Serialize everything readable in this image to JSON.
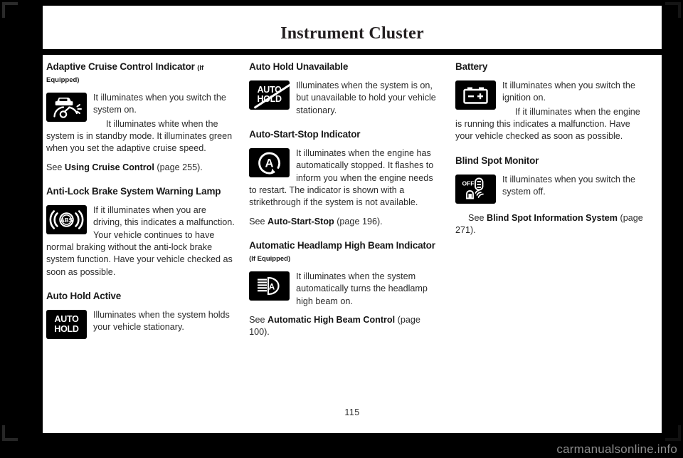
{
  "header": {
    "title": "Instrument Cluster"
  },
  "footer": {
    "page_number": "115",
    "watermark": "carmanualsonline.info"
  },
  "columns": [
    {
      "id": "column-left",
      "sections": [
        {
          "id": "adaptive-cruise-control-indicator",
          "title": "Adaptive Cruise Control Indicator",
          "qualifier": "(If Equipped)",
          "icon": "adaptive-cruise-control-icon",
          "icon_label": "",
          "paragraphs": [
            "It illuminates when you switch the system on.",
            "It illuminates white when the system is in standby mode.  It illuminates green when you set the adaptive cruise speed."
          ],
          "see_prefix": "See ",
          "see_bold": "Using Cruise Control",
          "see_suffix": " (page 255)."
        },
        {
          "id": "anti-lock-brake-system-warning-lamp",
          "title": "Anti-Lock Brake System Warning Lamp",
          "qualifier": "",
          "icon": "abs-warning-icon",
          "icon_label": "ABS",
          "paragraphs": [
            "If it illuminates when you are driving, this indicates a malfunction.  Your vehicle continues to have normal braking without the anti-lock brake system function.  Have your vehicle checked as soon as possible."
          ],
          "see_prefix": "",
          "see_bold": "",
          "see_suffix": ""
        },
        {
          "id": "auto-hold-active",
          "title": "Auto Hold Active",
          "qualifier": "",
          "icon": "auto-hold-icon",
          "icon_label_line1": "AUTO",
          "icon_label_line2": "HOLD",
          "paragraphs": [
            "Illuminates when the system holds your vehicle stationary."
          ],
          "see_prefix": "",
          "see_bold": "",
          "see_suffix": ""
        }
      ]
    },
    {
      "id": "column-middle",
      "sections": [
        {
          "id": "auto-hold-unavailable",
          "title": "Auto Hold Unavailable",
          "qualifier": "",
          "icon": "auto-hold-unavailable-icon",
          "icon_label_line1": "AUTO",
          "icon_label_line2": "HOLD",
          "paragraphs": [
            "Illuminates when the system is on, but unavailable to hold your vehicle stationary."
          ],
          "see_prefix": "",
          "see_bold": "",
          "see_suffix": ""
        },
        {
          "id": "auto-start-stop-indicator",
          "title": "Auto-Start-Stop Indicator",
          "qualifier": "",
          "icon": "auto-start-stop-icon",
          "icon_label": "A",
          "paragraphs": [
            "It illuminates when the engine has automatically stopped.  It flashes to inform you when the engine needs to restart.  The indicator is shown with a strikethrough if the system is not available."
          ],
          "see_prefix": "See ",
          "see_bold": "Auto-Start-Stop",
          "see_suffix": " (page 196)."
        },
        {
          "id": "automatic-headlamp-high-beam-indicator",
          "title": "Automatic Headlamp High Beam Indicator",
          "qualifier": "(If Equipped)",
          "icon": "automatic-high-beam-icon",
          "icon_label": "A",
          "paragraphs": [
            "It illuminates when the system automatically turns the headlamp high beam on."
          ],
          "see_prefix": "See ",
          "see_bold": "Automatic High Beam Control",
          "see_suffix": " (page 100)."
        }
      ]
    },
    {
      "id": "column-right",
      "sections": [
        {
          "id": "battery",
          "title": "Battery",
          "qualifier": "",
          "icon": "battery-icon",
          "icon_label": "",
          "paragraphs": [
            "It illuminates when you switch the ignition on.",
            "If it illuminates when the engine is running this indicates a malfunction.  Have your vehicle checked as soon as possible."
          ],
          "see_prefix": "",
          "see_bold": "",
          "see_suffix": ""
        },
        {
          "id": "blind-spot-monitor",
          "title": "Blind Spot Monitor",
          "qualifier": "",
          "icon": "blind-spot-monitor-off-icon",
          "icon_label": "OFF",
          "paragraphs": [
            "It illuminates when you switch the system off."
          ],
          "see_prefix": "See ",
          "see_bold": "Blind Spot Information System",
          "see_suffix": " (page 271)."
        }
      ]
    }
  ]
}
